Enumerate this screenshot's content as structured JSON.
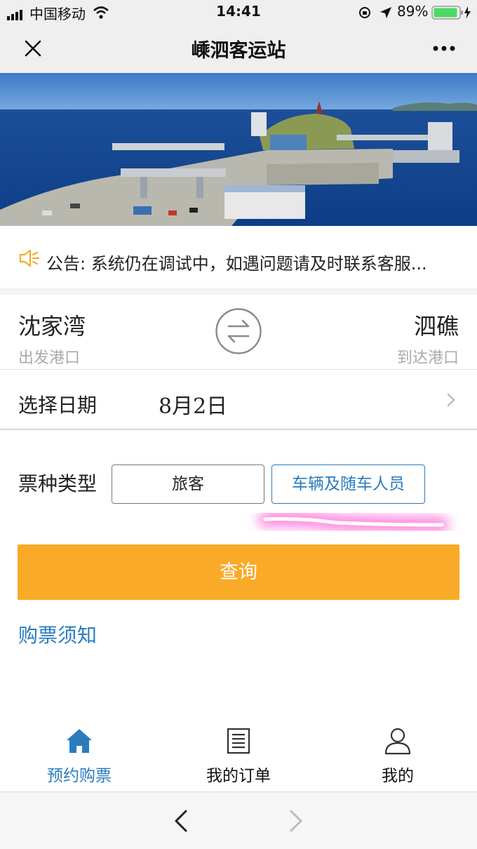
{
  "status_bar": {
    "carrier": "中国移动",
    "time": "14:41",
    "battery": "89%"
  },
  "nav": {
    "title": "嵊泗客运站",
    "close_icon": "close-icon",
    "more_icon": "more-icon"
  },
  "banner": {
    "alt": "ferry-terminal-photo"
  },
  "announcement": {
    "icon": "speaker-icon",
    "accent": "#f9aa27",
    "text": "公告: 系统仍在调试中，如遇问题请及时联系客服..."
  },
  "route": {
    "departure": {
      "name": "沈家湾",
      "label": "出发港口"
    },
    "arrival": {
      "name": "泗礁",
      "label": "到达港口"
    },
    "swap_icon": "swap-icon"
  },
  "date": {
    "label": "选择日期",
    "value": "8月2日"
  },
  "ticket_type": {
    "label": "票种类型",
    "options": [
      "旅客",
      "车辆及随车人员"
    ],
    "selected": "车辆及随车人员"
  },
  "query_button": {
    "label": "查询",
    "color": "#f9aa27"
  },
  "purchase_notice": {
    "label": "购票须知",
    "color": "#2a7cbf"
  },
  "tabs": [
    {
      "label": "预约购票",
      "icon": "home-icon",
      "active": true
    },
    {
      "label": "我的订单",
      "icon": "document-icon",
      "active": false
    },
    {
      "label": "我的",
      "icon": "user-icon",
      "active": false
    }
  ],
  "colors": {
    "accent_blue": "#2a7cbf",
    "accent_orange": "#f9aa27"
  }
}
